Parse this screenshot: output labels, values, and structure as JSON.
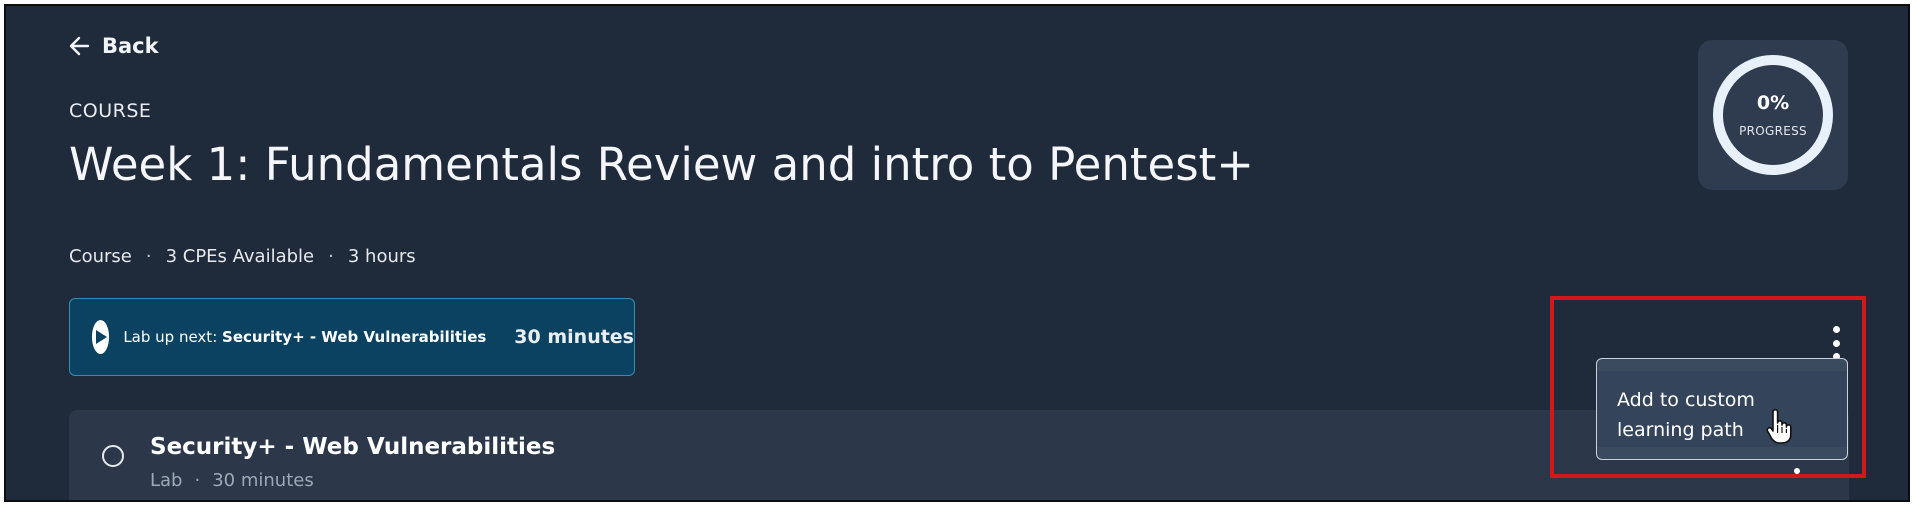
{
  "header": {
    "back_label": "Back",
    "eyebrow": "COURSE",
    "title": "Week 1: Fundamentals Review and intro to Pentest+",
    "meta": [
      "Course",
      "3 CPEs Available",
      "3 hours"
    ],
    "meta_separator": "·"
  },
  "progress": {
    "value_fraction": 0,
    "percent_label": "0%",
    "label": "PROGRESS"
  },
  "up_next": {
    "prefix": "Lab up next:",
    "item": "Security+ - Web Vulnerabilities",
    "duration": "30 minutes"
  },
  "menu": {
    "items": [
      "Add to custom learning path"
    ]
  },
  "course_items": [
    {
      "title": "Security+ - Web Vulnerabilities",
      "type": "Lab",
      "duration": "30 minutes",
      "separator": "·"
    }
  ],
  "colors": {
    "background": "#1f2a3a",
    "card": "#2f3b4e",
    "up_next_bg": "#0b4261",
    "up_next_border": "#2c8fb4",
    "highlight": "#d01a1a"
  }
}
